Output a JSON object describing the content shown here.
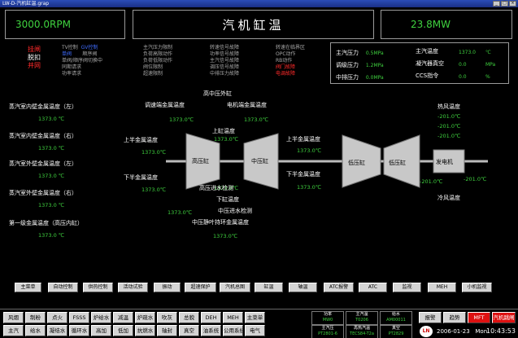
{
  "window": {
    "title": "LW-D-汽机缸温.grap"
  },
  "header": {
    "rpm": "3000.0RPM",
    "title": "汽机缸温",
    "mw": "23.8MW"
  },
  "control": {
    "col1": [
      "挂闸",
      "脱扣",
      "并网"
    ],
    "col2a": [
      "TV控制",
      "单阀",
      "单阀/顺序阀切换中",
      "同期请求",
      "功率请求"
    ],
    "col2b": [
      "GV控制",
      "顺序阀"
    ],
    "col3": [
      "主汽压力限制",
      "负荷高限动作",
      "负荷低限动作",
      "阀位限制",
      "超速限制"
    ],
    "col4": [
      "转速信号故障",
      "功率信号故障",
      "主汽信号故障",
      "调压信号故障",
      "中排压力故障"
    ],
    "col5": [
      "转速在临界区",
      "OPC动作",
      "RB动作",
      "阀门故障",
      "电调故障"
    ]
  },
  "pressures": {
    "items": [
      {
        "label": "主汽压力",
        "value": "0.5MPa"
      },
      {
        "label": "调级压力",
        "value": "1.2MPa"
      },
      {
        "label": "中排压力",
        "value": "0.0MPa"
      }
    ],
    "right": [
      {
        "label": "主汽温度",
        "value": "1373.0",
        "unit": "℃"
      },
      {
        "label": "凝汽器真空",
        "value": "0.0",
        "unit": "MPa"
      },
      {
        "label": "CCS指令",
        "value": "0.0",
        "unit": "%"
      }
    ]
  },
  "left_temps": [
    {
      "label": "蒸汽室内壁金属温度（左）",
      "value": "1373.0 ℃"
    },
    {
      "label": "蒸汽室内壁金属温度（右）",
      "value": "1373.0 ℃"
    },
    {
      "label": "蒸汽室外壁金属温度（左）",
      "value": "1373.0 ℃"
    },
    {
      "label": "蒸汽室外壁金属温度（右）",
      "value": "1373.0 ℃"
    },
    {
      "label": "第一级金属温度（高压内缸）",
      "value": "1373.0 ℃"
    }
  ],
  "mid_temps": {
    "hp_outer": "高中压外缸",
    "reg_valve": {
      "label": "调速端金属温度",
      "value": "1373.0℃"
    },
    "gen_end": {
      "label": "电机端金属温度",
      "value": "1373.0℃"
    },
    "upper_half": {
      "label": "上半金属温度",
      "value": "1373.0℃"
    },
    "lower_half": {
      "label": "下半金属温度",
      "value": "1373.0℃"
    },
    "upper_cyl": {
      "label": "上缸温度",
      "value": "1373.0℃"
    },
    "lower_cyl": {
      "label": "下缸温度",
      "value": "1373.0℃"
    },
    "ip_upper": {
      "label": "上半金属温度",
      "value": "1373.0℃"
    },
    "ip_lower": {
      "label": "下半金属温度",
      "value": "1373.0℃"
    },
    "ip_drain": {
      "label": "中压进水检测",
      "value": "1373.0℃"
    },
    "ip_static": {
      "label": "中压静叶持环金属温度",
      "value": "1373.0℃"
    },
    "hp_drain_label": "高压进水检测"
  },
  "right_temps": {
    "hot": "热风温度",
    "hot_vals": [
      "-201.0℃",
      "-201.0℃",
      "-201.0℃"
    ],
    "cold": "冷风温度",
    "cold_vals": [
      "-201.0℃",
      "-201.0℃"
    ]
  },
  "turbine": {
    "hp": "高压缸",
    "ip": "中压缸",
    "lp1": "低压缸",
    "lp2": "低压缸",
    "gen": "发电机"
  },
  "buttons": [
    "主菜单",
    "自动控制",
    "供热控制",
    "活动试验",
    "振动",
    "超速保护",
    "汽机总图",
    "缸温",
    "轴温",
    "ATC报警",
    "ATC",
    "监视",
    "MEH",
    "小机监视"
  ],
  "nav_row1": [
    "风烟",
    "制粉",
    "点火",
    "FSSS",
    "炉给水",
    "减温",
    "炉疏水",
    "吹灰",
    "总貌",
    "DEH",
    "MEH",
    "主菜单"
  ],
  "nav_row2": [
    "主汽",
    "给水",
    "凝结水",
    "循环水",
    "高加",
    "低加",
    "抗燃水",
    "轴封",
    "真空",
    "油系统",
    "公用系统",
    "电气"
  ],
  "status": [
    {
      "label": "功率",
      "value": "MW0"
    },
    {
      "label": "主汽温",
      "value": "T0206"
    },
    {
      "label": "给水",
      "value": "AM00011"
    },
    {
      "label": "主汽压",
      "value": "PT2801-6"
    },
    {
      "label": "再热汽温",
      "value": "TECS84-T2a"
    },
    {
      "label": "真空",
      "value": "PT2829"
    }
  ],
  "alarms": {
    "alarm": "报警",
    "trend": "趋势",
    "mft": "MFT",
    "tripped": "汽机跳闸"
  },
  "clock": {
    "date": "2006-01-23",
    "day": "Mon",
    "time": "10:43:53"
  }
}
